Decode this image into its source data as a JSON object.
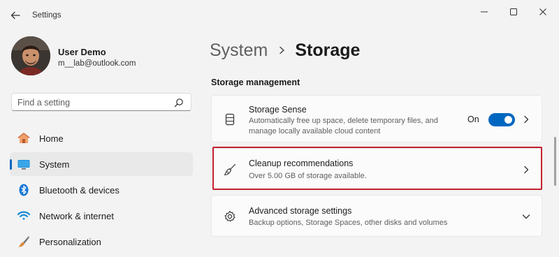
{
  "window": {
    "title": "Settings"
  },
  "profile": {
    "name": "User Demo",
    "email": "m__lab@outlook.com"
  },
  "search": {
    "placeholder": "Find a setting"
  },
  "sidebar": {
    "items": [
      {
        "label": "Home",
        "icon": "home-icon",
        "active": false
      },
      {
        "label": "System",
        "icon": "system-icon",
        "active": true
      },
      {
        "label": "Bluetooth & devices",
        "icon": "bluetooth-icon",
        "active": false
      },
      {
        "label": "Network & internet",
        "icon": "wifi-icon",
        "active": false
      },
      {
        "label": "Personalization",
        "icon": "brush-icon",
        "active": false
      }
    ]
  },
  "breadcrumb": {
    "parent": "System",
    "current": "Storage"
  },
  "section": {
    "title": "Storage management"
  },
  "cards": [
    {
      "title": "Storage Sense",
      "desc_line1": "Automatically free up space, delete temporary files, and",
      "desc_line2": "manage locally available cloud content",
      "icon": "storage-drive-icon",
      "toggle_label": "On",
      "toggle_on": true
    },
    {
      "title": "Cleanup recommendations",
      "desc": "Over 5.00 GB of storage available.",
      "icon": "broom-icon"
    },
    {
      "title": "Advanced storage settings",
      "desc": "Backup options, Storage Spaces, other disks and volumes",
      "icon": "gear-icon"
    }
  ],
  "colors": {
    "accent": "#0067c0",
    "highlight": "#c4202f",
    "background": "#f3f3f3"
  }
}
